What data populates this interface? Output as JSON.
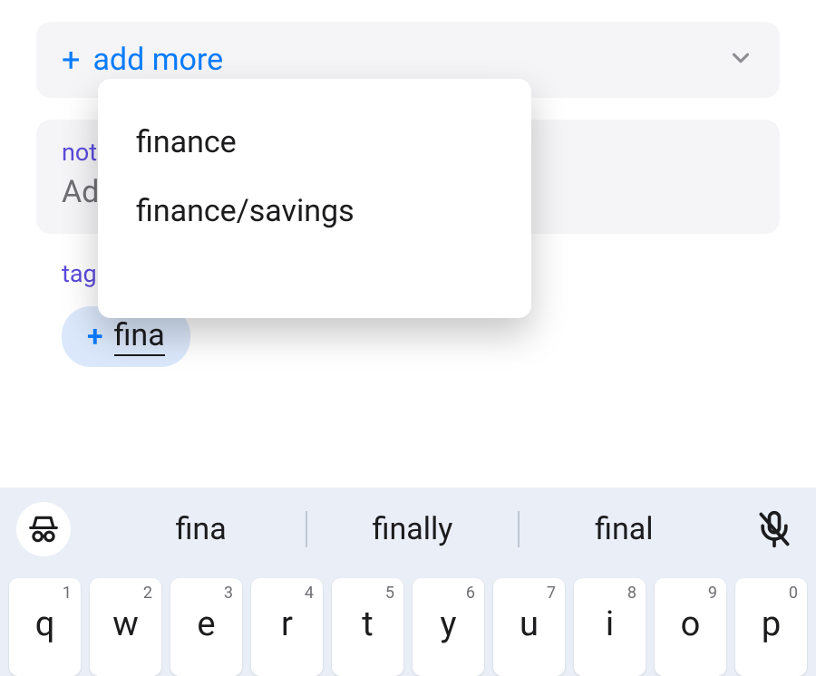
{
  "add_more": {
    "label": "add more"
  },
  "notes": {
    "label": "notes",
    "placeholder": "Add notes about this item here."
  },
  "tags": {
    "label": "tags",
    "input_value": "fina"
  },
  "autocomplete": {
    "items": [
      "finance",
      "finance/savings"
    ]
  },
  "keyboard": {
    "suggestions": [
      "fina",
      "finally",
      "final"
    ],
    "row": [
      {
        "letter": "q",
        "digit": "1"
      },
      {
        "letter": "w",
        "digit": "2"
      },
      {
        "letter": "e",
        "digit": "3"
      },
      {
        "letter": "r",
        "digit": "4"
      },
      {
        "letter": "t",
        "digit": "5"
      },
      {
        "letter": "y",
        "digit": "6"
      },
      {
        "letter": "u",
        "digit": "7"
      },
      {
        "letter": "i",
        "digit": "8"
      },
      {
        "letter": "o",
        "digit": "9"
      },
      {
        "letter": "p",
        "digit": "0"
      }
    ]
  }
}
